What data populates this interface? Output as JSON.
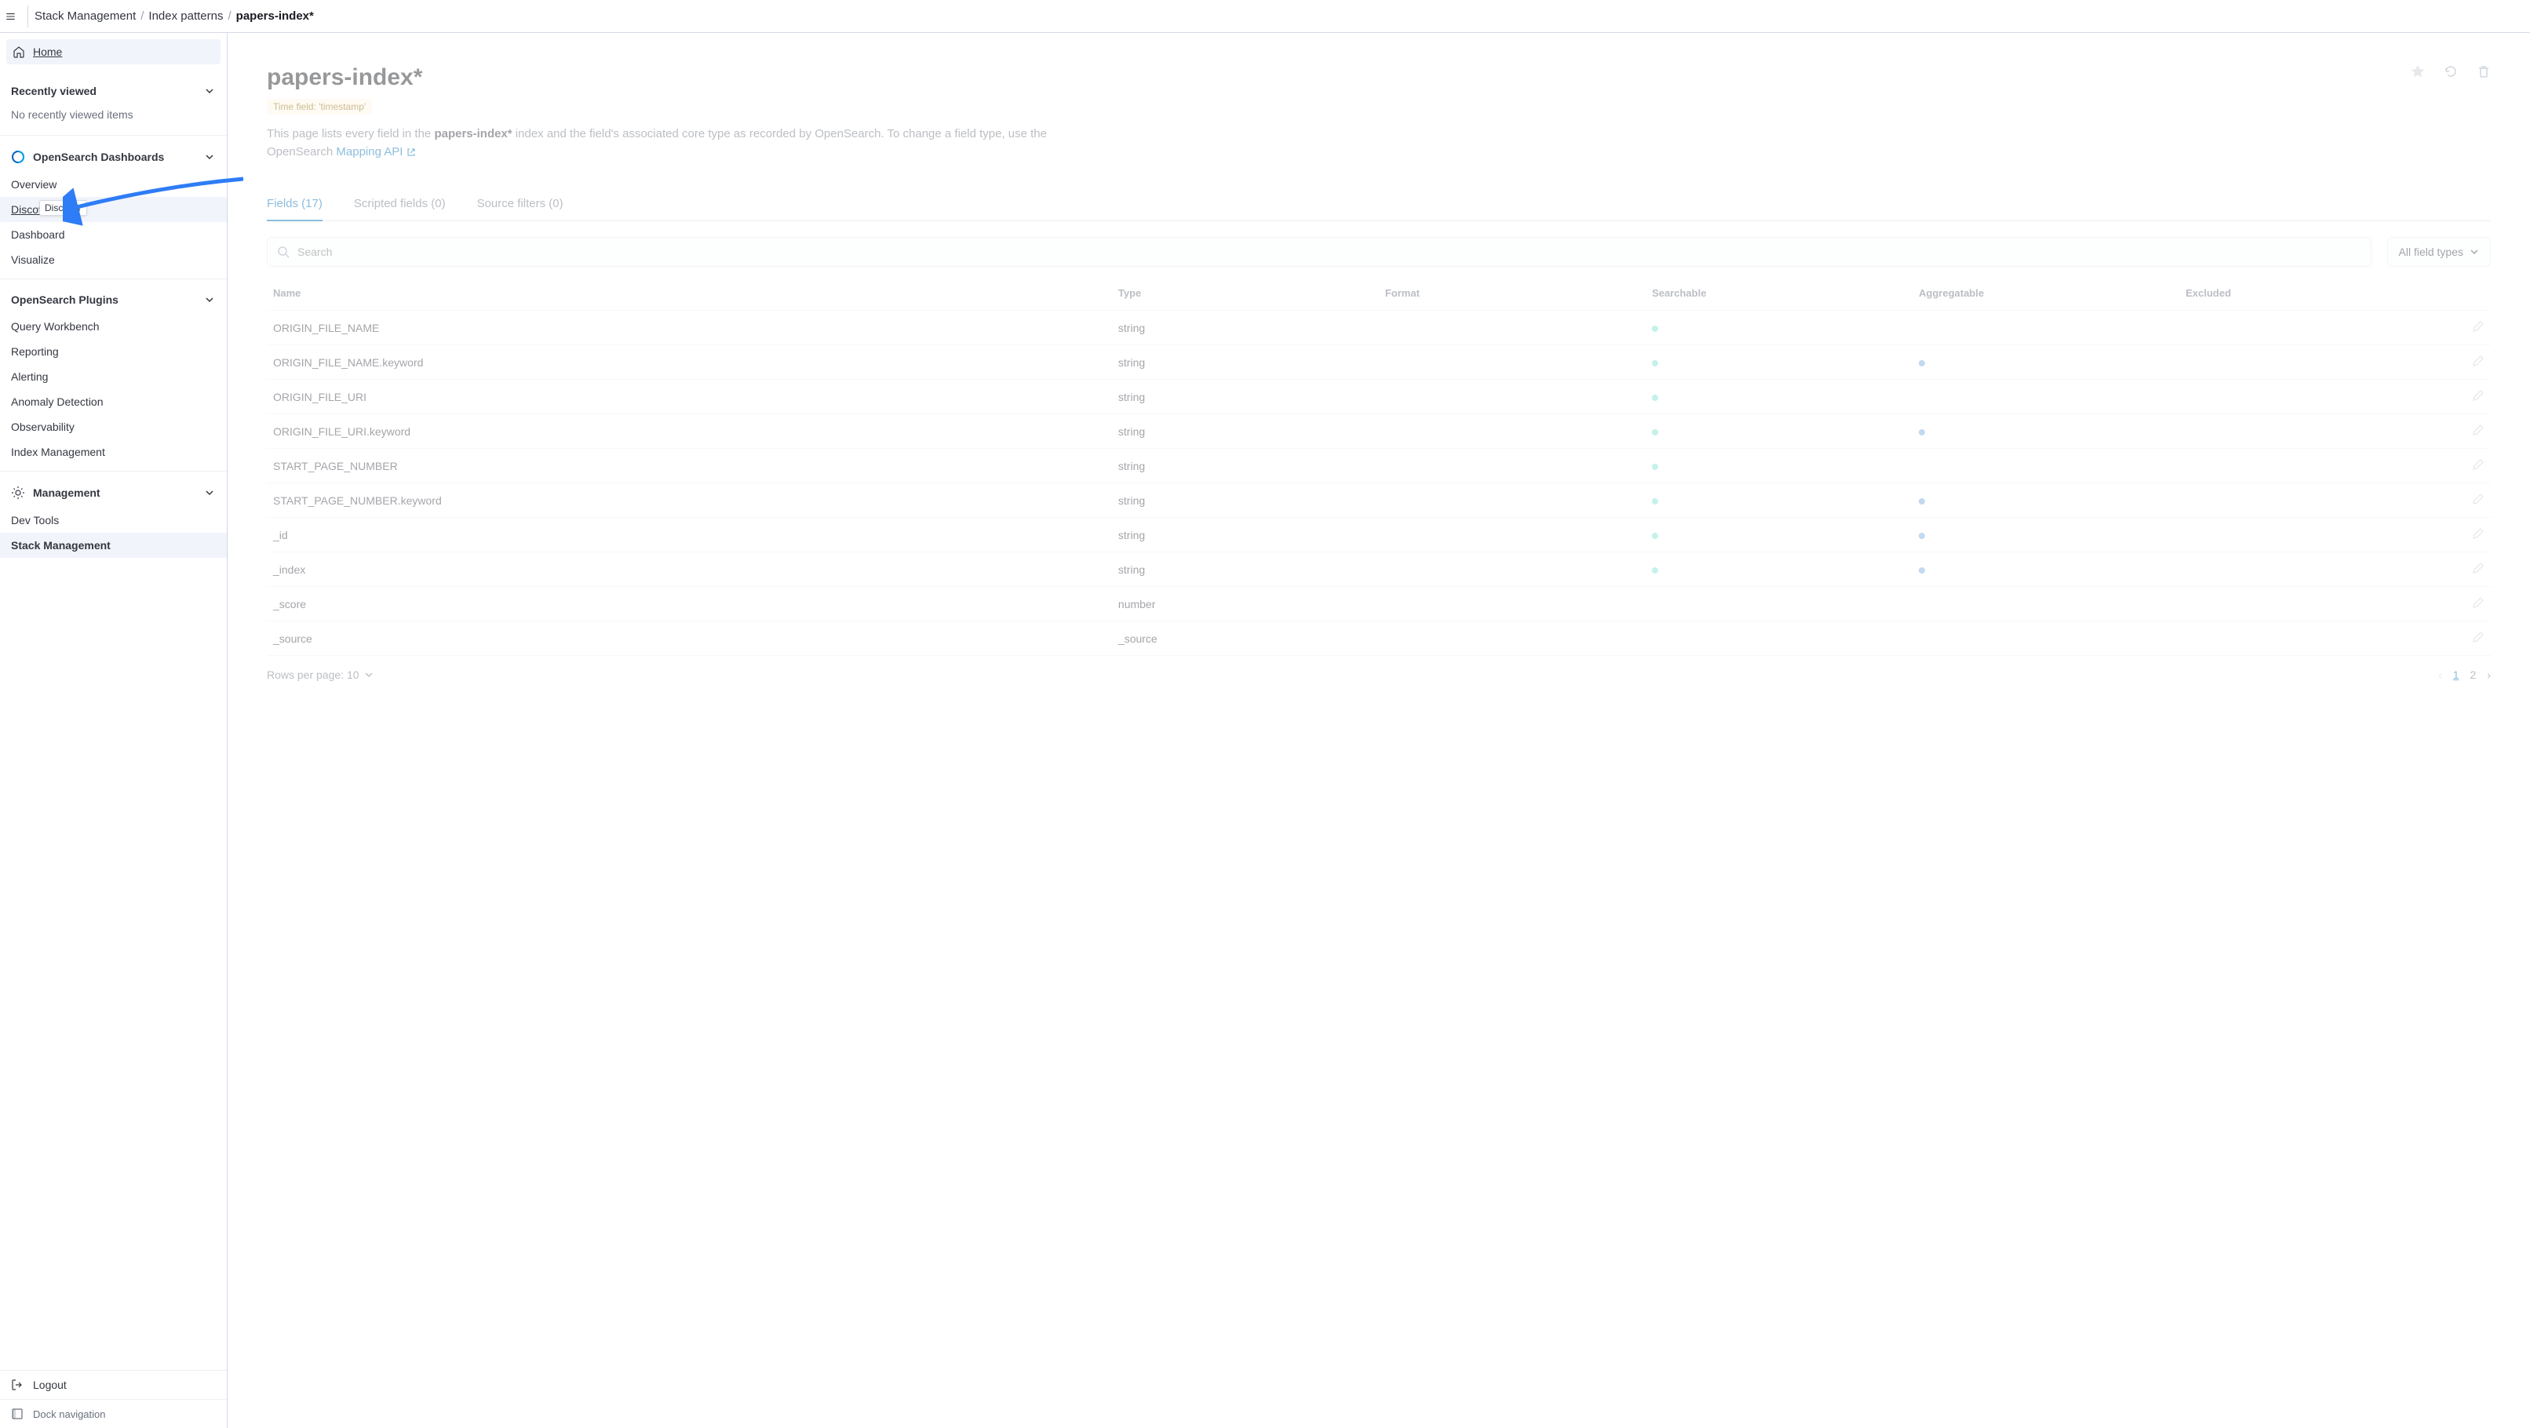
{
  "breadcrumb": {
    "stack": "Stack Management",
    "mid": "Index patterns",
    "current": "papers-index*"
  },
  "sidebar": {
    "home": "Home",
    "recently_viewed": {
      "title": "Recently viewed",
      "empty": "No recently viewed items"
    },
    "dashboards": {
      "title": "OpenSearch Dashboards",
      "items": [
        {
          "label": "Overview"
        },
        {
          "label": "Discover",
          "tooltip": "Discover"
        },
        {
          "label": "Dashboard"
        },
        {
          "label": "Visualize"
        }
      ]
    },
    "plugins": {
      "title": "OpenSearch Plugins",
      "items": [
        {
          "label": "Query Workbench"
        },
        {
          "label": "Reporting"
        },
        {
          "label": "Alerting"
        },
        {
          "label": "Anomaly Detection"
        },
        {
          "label": "Observability"
        },
        {
          "label": "Index Management"
        }
      ]
    },
    "management": {
      "title": "Management",
      "items": [
        {
          "label": "Dev Tools"
        },
        {
          "label": "Stack Management"
        }
      ]
    },
    "logout": "Logout",
    "dock": "Dock navigation"
  },
  "main": {
    "title": "papers-index*",
    "time_badge": "Time field: 'timestamp'",
    "desc_prefix": "This page lists every field in the ",
    "desc_index": "papers-index*",
    "desc_mid": " index and the field's associated core type as recorded by OpenSearch. To change a field type, use the OpenSearch ",
    "desc_link": "Mapping API",
    "tabs": {
      "fields": "Fields (17)",
      "scripted": "Scripted fields (0)",
      "source": "Source filters (0)"
    },
    "search_placeholder": "Search",
    "filter_label": "All field types",
    "columns": {
      "name": "Name",
      "type": "Type",
      "format": "Format",
      "searchable": "Searchable",
      "aggregatable": "Aggregatable",
      "excluded": "Excluded"
    },
    "rows": [
      {
        "name": "ORIGIN_FILE_NAME",
        "type": "string",
        "searchable": true,
        "aggregatable": false
      },
      {
        "name": "ORIGIN_FILE_NAME.keyword",
        "type": "string",
        "searchable": true,
        "aggregatable": true
      },
      {
        "name": "ORIGIN_FILE_URI",
        "type": "string",
        "searchable": true,
        "aggregatable": false
      },
      {
        "name": "ORIGIN_FILE_URI.keyword",
        "type": "string",
        "searchable": true,
        "aggregatable": true
      },
      {
        "name": "START_PAGE_NUMBER",
        "type": "string",
        "searchable": true,
        "aggregatable": false
      },
      {
        "name": "START_PAGE_NUMBER.keyword",
        "type": "string",
        "searchable": true,
        "aggregatable": true
      },
      {
        "name": "_id",
        "type": "string",
        "searchable": true,
        "aggregatable": true
      },
      {
        "name": "_index",
        "type": "string",
        "searchable": true,
        "aggregatable": true
      },
      {
        "name": "_score",
        "type": "number",
        "searchable": false,
        "aggregatable": false
      },
      {
        "name": "_source",
        "type": "_source",
        "searchable": false,
        "aggregatable": false
      }
    ],
    "rows_per_page_label": "Rows per page: 10",
    "pages": {
      "p1": "1",
      "p2": "2"
    }
  }
}
